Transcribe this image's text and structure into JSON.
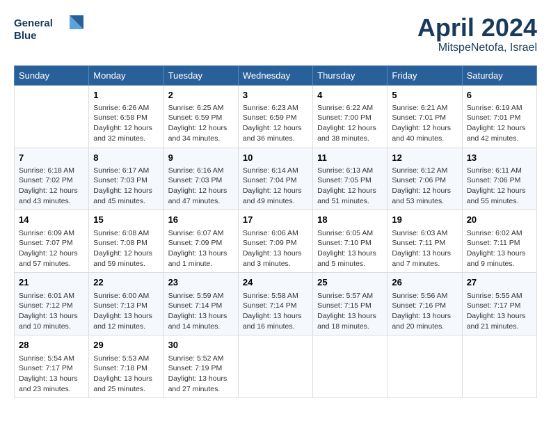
{
  "header": {
    "logo_line1": "General",
    "logo_line2": "Blue",
    "month": "April 2024",
    "location": "MitspeNetofa, Israel"
  },
  "weekdays": [
    "Sunday",
    "Monday",
    "Tuesday",
    "Wednesday",
    "Thursday",
    "Friday",
    "Saturday"
  ],
  "weeks": [
    [
      {
        "day": "",
        "info": ""
      },
      {
        "day": "1",
        "info": "Sunrise: 6:26 AM\nSunset: 6:58 PM\nDaylight: 12 hours\nand 32 minutes."
      },
      {
        "day": "2",
        "info": "Sunrise: 6:25 AM\nSunset: 6:59 PM\nDaylight: 12 hours\nand 34 minutes."
      },
      {
        "day": "3",
        "info": "Sunrise: 6:23 AM\nSunset: 6:59 PM\nDaylight: 12 hours\nand 36 minutes."
      },
      {
        "day": "4",
        "info": "Sunrise: 6:22 AM\nSunset: 7:00 PM\nDaylight: 12 hours\nand 38 minutes."
      },
      {
        "day": "5",
        "info": "Sunrise: 6:21 AM\nSunset: 7:01 PM\nDaylight: 12 hours\nand 40 minutes."
      },
      {
        "day": "6",
        "info": "Sunrise: 6:19 AM\nSunset: 7:01 PM\nDaylight: 12 hours\nand 42 minutes."
      }
    ],
    [
      {
        "day": "7",
        "info": "Sunrise: 6:18 AM\nSunset: 7:02 PM\nDaylight: 12 hours\nand 43 minutes."
      },
      {
        "day": "8",
        "info": "Sunrise: 6:17 AM\nSunset: 7:03 PM\nDaylight: 12 hours\nand 45 minutes."
      },
      {
        "day": "9",
        "info": "Sunrise: 6:16 AM\nSunset: 7:03 PM\nDaylight: 12 hours\nand 47 minutes."
      },
      {
        "day": "10",
        "info": "Sunrise: 6:14 AM\nSunset: 7:04 PM\nDaylight: 12 hours\nand 49 minutes."
      },
      {
        "day": "11",
        "info": "Sunrise: 6:13 AM\nSunset: 7:05 PM\nDaylight: 12 hours\nand 51 minutes."
      },
      {
        "day": "12",
        "info": "Sunrise: 6:12 AM\nSunset: 7:06 PM\nDaylight: 12 hours\nand 53 minutes."
      },
      {
        "day": "13",
        "info": "Sunrise: 6:11 AM\nSunset: 7:06 PM\nDaylight: 12 hours\nand 55 minutes."
      }
    ],
    [
      {
        "day": "14",
        "info": "Sunrise: 6:09 AM\nSunset: 7:07 PM\nDaylight: 12 hours\nand 57 minutes."
      },
      {
        "day": "15",
        "info": "Sunrise: 6:08 AM\nSunset: 7:08 PM\nDaylight: 12 hours\nand 59 minutes."
      },
      {
        "day": "16",
        "info": "Sunrise: 6:07 AM\nSunset: 7:09 PM\nDaylight: 13 hours\nand 1 minute."
      },
      {
        "day": "17",
        "info": "Sunrise: 6:06 AM\nSunset: 7:09 PM\nDaylight: 13 hours\nand 3 minutes."
      },
      {
        "day": "18",
        "info": "Sunrise: 6:05 AM\nSunset: 7:10 PM\nDaylight: 13 hours\nand 5 minutes."
      },
      {
        "day": "19",
        "info": "Sunrise: 6:03 AM\nSunset: 7:11 PM\nDaylight: 13 hours\nand 7 minutes."
      },
      {
        "day": "20",
        "info": "Sunrise: 6:02 AM\nSunset: 7:11 PM\nDaylight: 13 hours\nand 9 minutes."
      }
    ],
    [
      {
        "day": "21",
        "info": "Sunrise: 6:01 AM\nSunset: 7:12 PM\nDaylight: 13 hours\nand 10 minutes."
      },
      {
        "day": "22",
        "info": "Sunrise: 6:00 AM\nSunset: 7:13 PM\nDaylight: 13 hours\nand 12 minutes."
      },
      {
        "day": "23",
        "info": "Sunrise: 5:59 AM\nSunset: 7:14 PM\nDaylight: 13 hours\nand 14 minutes."
      },
      {
        "day": "24",
        "info": "Sunrise: 5:58 AM\nSunset: 7:14 PM\nDaylight: 13 hours\nand 16 minutes."
      },
      {
        "day": "25",
        "info": "Sunrise: 5:57 AM\nSunset: 7:15 PM\nDaylight: 13 hours\nand 18 minutes."
      },
      {
        "day": "26",
        "info": "Sunrise: 5:56 AM\nSunset: 7:16 PM\nDaylight: 13 hours\nand 20 minutes."
      },
      {
        "day": "27",
        "info": "Sunrise: 5:55 AM\nSunset: 7:17 PM\nDaylight: 13 hours\nand 21 minutes."
      }
    ],
    [
      {
        "day": "28",
        "info": "Sunrise: 5:54 AM\nSunset: 7:17 PM\nDaylight: 13 hours\nand 23 minutes."
      },
      {
        "day": "29",
        "info": "Sunrise: 5:53 AM\nSunset: 7:18 PM\nDaylight: 13 hours\nand 25 minutes."
      },
      {
        "day": "30",
        "info": "Sunrise: 5:52 AM\nSunset: 7:19 PM\nDaylight: 13 hours\nand 27 minutes."
      },
      {
        "day": "",
        "info": ""
      },
      {
        "day": "",
        "info": ""
      },
      {
        "day": "",
        "info": ""
      },
      {
        "day": "",
        "info": ""
      }
    ]
  ]
}
